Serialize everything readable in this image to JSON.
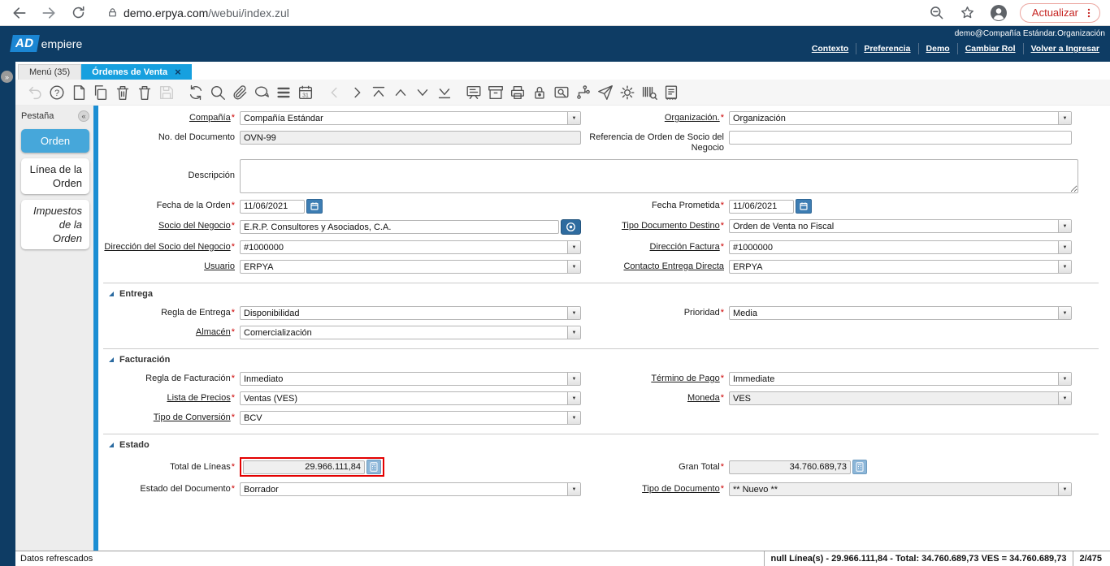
{
  "ui": {
    "required_marker": "*",
    "dropdown_glyph": "▼",
    "close_glyph": "×",
    "collapse_glyph": "«",
    "expand_glyph": "»"
  },
  "browser": {
    "url_host": "demo.erpya.com",
    "url_path": "/webui/index.zul",
    "action_button": "Actualizar"
  },
  "header": {
    "logo_primary": "AD",
    "logo_secondary": "empiere",
    "session": "demo@Compañía Estándar.Organización",
    "links": [
      "Contexto",
      "Preferencia",
      "Demo",
      "Cambiar Rol",
      "Volver a Ingresar"
    ]
  },
  "tabs": {
    "menu_tab": "Menú (35)",
    "active_tab": "Órdenes de Venta"
  },
  "sidebar": {
    "title": "Pestaña",
    "tabs": [
      {
        "label": "Orden"
      },
      {
        "label": "Línea de la Orden"
      },
      {
        "label": "Impuestos de la Orden"
      }
    ]
  },
  "form": {
    "sections": {
      "entrega": "Entrega",
      "facturacion": "Facturación",
      "estado": "Estado"
    },
    "fields": {
      "compania": {
        "label": "Compañía",
        "value": "Compañía Estándar"
      },
      "organizacion": {
        "label": "Organización.",
        "value": "Organización"
      },
      "no_documento": {
        "label": "No. del Documento",
        "value": "OVN-99"
      },
      "referencia": {
        "label": "Referencia de Orden de Socio del Negocio",
        "value": ""
      },
      "descripcion": {
        "label": "Descripción",
        "value": ""
      },
      "fecha_orden": {
        "label": "Fecha de la Orden",
        "value": "11/06/2021"
      },
      "fecha_prometida": {
        "label": "Fecha Prometida",
        "value": "11/06/2021"
      },
      "socio": {
        "label": "Socio del Negocio",
        "value": "E.R.P. Consultores y Asociados, C.A."
      },
      "tipo_doc_destino": {
        "label": "Tipo Documento Destino",
        "value": "Orden de Venta no Fiscal"
      },
      "direccion_socio": {
        "label": "Dirección del Socio del Negocio",
        "value": "#1000000"
      },
      "direccion_factura": {
        "label": "Dirección Factura",
        "value": "#1000000"
      },
      "usuario": {
        "label": "Usuario",
        "value": "ERPYA"
      },
      "contacto": {
        "label": "Contacto Entrega Directa",
        "value": "ERPYA"
      },
      "regla_entrega": {
        "label": "Regla de Entrega",
        "value": "Disponibilidad"
      },
      "prioridad": {
        "label": "Prioridad",
        "value": "Media"
      },
      "almacen": {
        "label": "Almacén",
        "value": "Comercialización"
      },
      "regla_facturacion": {
        "label": "Regla de Facturación",
        "value": "Inmediato"
      },
      "termino_pago": {
        "label": "Término de Pago",
        "value": "Immediate"
      },
      "lista_precios": {
        "label": "Lista de Precios",
        "value": "Ventas (VES)"
      },
      "moneda": {
        "label": "Moneda",
        "value": "VES"
      },
      "tipo_conversion": {
        "label": "Tipo de Conversión",
        "value": "BCV"
      },
      "total_lineas": {
        "label": "Total de Líneas",
        "value": "29.966.111,84"
      },
      "gran_total": {
        "label": "Gran Total",
        "value": "34.760.689,73"
      },
      "estado_documento": {
        "label": "Estado del Documento",
        "value": "Borrador"
      },
      "tipo_documento": {
        "label": "Tipo de Documento",
        "value": "** Nuevo **"
      }
    }
  },
  "statusbar": {
    "message": "Datos refrescados",
    "summary": "null Línea(s) - 29.966.111,84 - Total: 34.760.689,73 VES = 34.760.689,73",
    "record_position": "2/475"
  }
}
